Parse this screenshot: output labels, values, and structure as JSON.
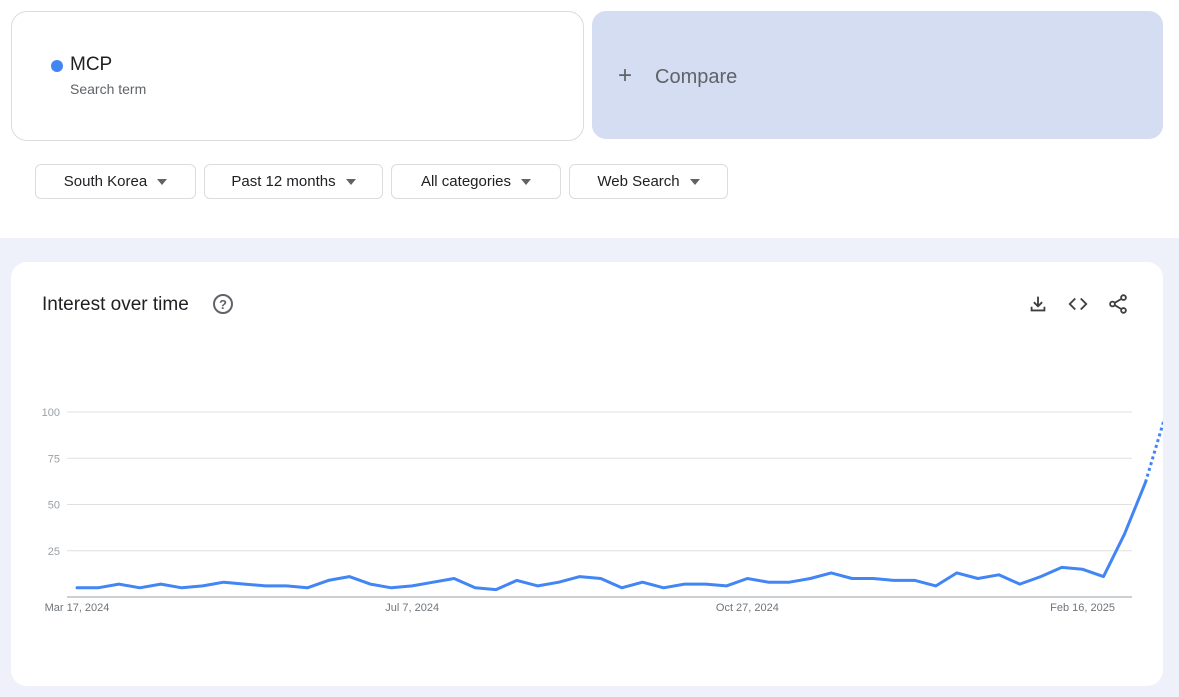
{
  "search_term": {
    "name": "MCP",
    "subtitle": "Search term",
    "color": "#4285f4"
  },
  "compare": {
    "icon": "plus-icon",
    "plus": "+",
    "label": "Compare"
  },
  "filters": {
    "region": "South Korea",
    "period": "Past 12 months",
    "category": "All categories",
    "property": "Web Search"
  },
  "chart_section": {
    "title": "Interest over time",
    "help_icon": "help-icon"
  },
  "toolbar": {
    "download_icon": "download-icon",
    "embed_icon": "embed-code-icon",
    "share_icon": "share-icon"
  },
  "chart_data": {
    "type": "line",
    "title": "Interest over time",
    "xlabel": "",
    "ylabel": "",
    "ylim": [
      0,
      100
    ],
    "y_ticks": [
      25,
      50,
      75,
      100
    ],
    "x_tick_labels": [
      "Mar 17, 2024",
      "Jul 7, 2024",
      "Oct 27, 2024",
      "Feb 16, 2025"
    ],
    "x_tick_indices": [
      0,
      16,
      32,
      48
    ],
    "grid": true,
    "series": [
      {
        "color": "#4285f4",
        "values": [
          5,
          5,
          7,
          5,
          7,
          5,
          6,
          8,
          7,
          6,
          6,
          5,
          9,
          11,
          7,
          5,
          6,
          8,
          10,
          5,
          4,
          9,
          6,
          8,
          11,
          10,
          5,
          8,
          5,
          7,
          7,
          6,
          10,
          8,
          8,
          10,
          13,
          10,
          10,
          9,
          9,
          6,
          13,
          10,
          12,
          7,
          11,
          16,
          15,
          11,
          34,
          62,
          100
        ],
        "partial_from_index": 51
      }
    ]
  }
}
